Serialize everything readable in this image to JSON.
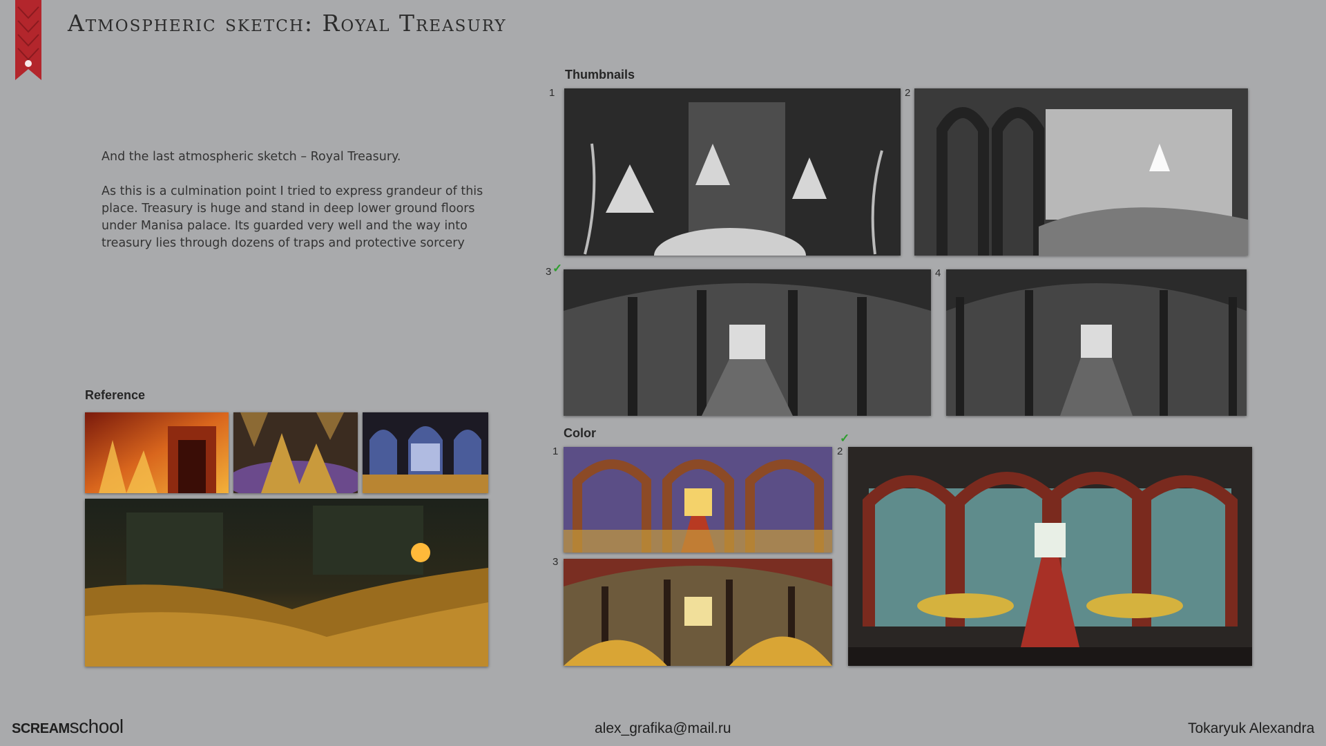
{
  "header": {
    "title": "Atmospheric sketch: Royal Treasury"
  },
  "description": {
    "intro": "And the last atmospheric sketch – Royal Treasury.",
    "body": "As this is a culmination point I tried to express grandeur of this place. Treasury is huge and stand in deep lower ground floors under Manisa palace. Its guarded very well and the way into treasury lies through dozens of traps and protective sorcery"
  },
  "reference": {
    "label": "Reference"
  },
  "thumbnails": {
    "label": "Thumbnails",
    "items": [
      {
        "number": "1"
      },
      {
        "number": "2"
      },
      {
        "number": "3",
        "selected": true
      },
      {
        "number": "4"
      }
    ]
  },
  "color": {
    "label": "Color",
    "items": [
      {
        "number": "1"
      },
      {
        "number": "2",
        "selected": true
      },
      {
        "number": "3"
      }
    ]
  },
  "colors": {
    "background": "#a9aaac",
    "ribbon": "#b3262c",
    "check": "#2e9e2e"
  },
  "footer": {
    "logo_part1": "scream",
    "logo_part2": "school",
    "email": "alex_grafika@mail.ru",
    "author": "Tokaryuk Alexandra"
  }
}
